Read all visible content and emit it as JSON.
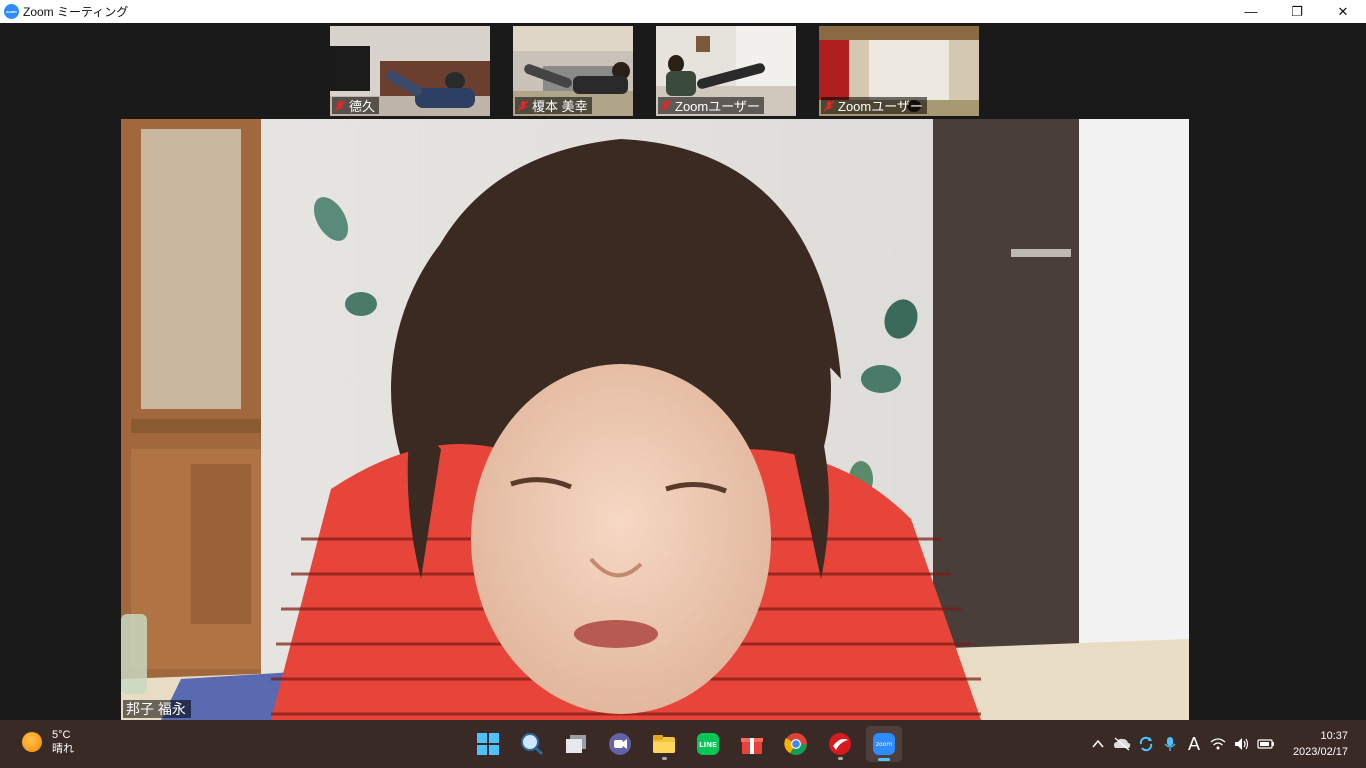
{
  "window": {
    "title": "Zoom ミーティング",
    "app_icon_text": "zoom",
    "minimize_glyph": "—",
    "restore_glyph": "❐",
    "close_glyph": "✕"
  },
  "thumbnails": [
    {
      "name": "德久",
      "muted": true
    },
    {
      "name": "榎本 美幸",
      "muted": true
    },
    {
      "name": "Zoomユーザー",
      "muted": true
    },
    {
      "name": "Zoomユーザー",
      "muted": true
    }
  ],
  "main_video": {
    "name": "邦子 福永"
  },
  "taskbar": {
    "weather_temp": "5°C",
    "weather_desc": "晴れ",
    "icons": [
      "windows-start-icon",
      "search-icon",
      "task-view-icon",
      "teams-chat-icon",
      "file-explorer-icon",
      "line-icon",
      "gift-icon",
      "chrome-icon",
      "trend-micro-icon",
      "zoom-icon"
    ],
    "zoom_label": "zoom",
    "line_label": "LINE",
    "ime_label": "A",
    "time": "10:37",
    "date": "2023/02/17"
  },
  "colors": {
    "accent": "#2d8cff",
    "muted_red": "#e02828",
    "taskbar_bg": "#3a2a26"
  }
}
